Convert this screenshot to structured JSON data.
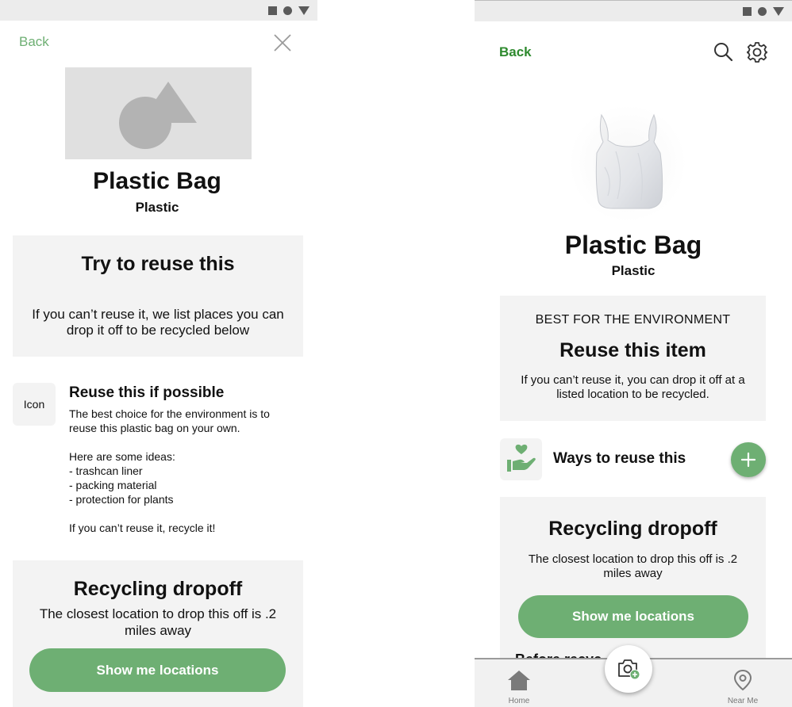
{
  "colors": {
    "accent": "#6eaf73",
    "back_left": "#6eaf73",
    "back_right": "#2e8a2e",
    "card_bg": "#f3f3f3",
    "placeholder": "#e0e0e0"
  },
  "left": {
    "header": {
      "back_label": "Back",
      "close_icon": "close-icon"
    },
    "image": {
      "icon": "image-placeholder-icon"
    },
    "product": {
      "title": "Plastic Bag",
      "material": "Plastic"
    },
    "reuse_card": {
      "heading": "Try to reuse this",
      "body": "If you can’t reuse it, we list places you can drop it off to be recycled below"
    },
    "reuse_section": {
      "icon_label": "Icon",
      "title": "Reuse this if possible",
      "intro": "The best choice for the environment is to reuse this plastic bag on your own.",
      "ideas_heading": "Here are some ideas:",
      "ideas": [
        "- trashcan liner",
        "- packing material",
        "- protection for plants"
      ],
      "outro": "If you can’t reuse it, recycle it!"
    },
    "dropoff": {
      "heading": "Recycling dropoff",
      "body": "The closest location to drop this off is .2 miles away",
      "button": "Show me locations"
    }
  },
  "right": {
    "header": {
      "back_label": "Back",
      "search_icon": "search-icon",
      "settings_icon": "gear-icon"
    },
    "product": {
      "title": "Plastic Bag",
      "material": "Plastic"
    },
    "env_card": {
      "label": "BEST FOR THE ENVIRONMENT",
      "heading": "Reuse this item",
      "body": "If you can’t reuse it, you can drop it off at a listed location to be recycled."
    },
    "ways": {
      "label": "Ways to reuse this",
      "icon": "hand-heart-icon",
      "add_icon": "plus-icon"
    },
    "dropoff": {
      "heading": "Recycling dropoff",
      "body": "The closest location to drop this off is .2 miles away",
      "button": "Show me locations"
    },
    "peek_text": "Before recyc",
    "nav": {
      "home": "Home",
      "near": "Near Me",
      "camera_icon": "camera-add-icon"
    }
  }
}
